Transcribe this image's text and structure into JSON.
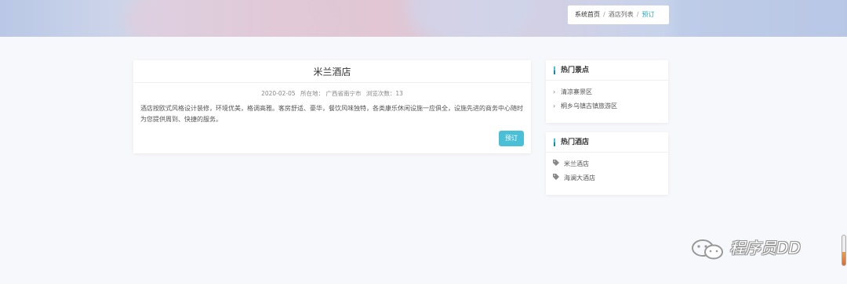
{
  "breadcrumb": {
    "home": "系统首页",
    "list": "酒店列表",
    "current": "预订",
    "separator": "/"
  },
  "hotel": {
    "name": "米兰酒店",
    "date": "2020-02-05",
    "location": "所在地：  广西省南宁市",
    "views": "浏览次数：13",
    "description": "酒店按欧式风格设计装修，环境优美，格调高雅。客房舒适、豪华，餐饮风味独特，各类康乐休闲设施一应俱全，设施先进的商务中心随时为您提供周到、快捷的服务。",
    "book_label": "预订"
  },
  "sidebar": {
    "spots": {
      "title": "热门景点",
      "items": [
        "清凉寨景区",
        "桐乡乌镇古镇旅游区"
      ]
    },
    "hotels": {
      "title": "热门酒店",
      "items": [
        "米兰酒店",
        "海澜大酒店"
      ]
    }
  },
  "watermark": "程序员DD",
  "colors": {
    "accent": "#4bbfd6",
    "breadcrumb_active": "#2aa7b8",
    "background": "#f7f8fc"
  }
}
